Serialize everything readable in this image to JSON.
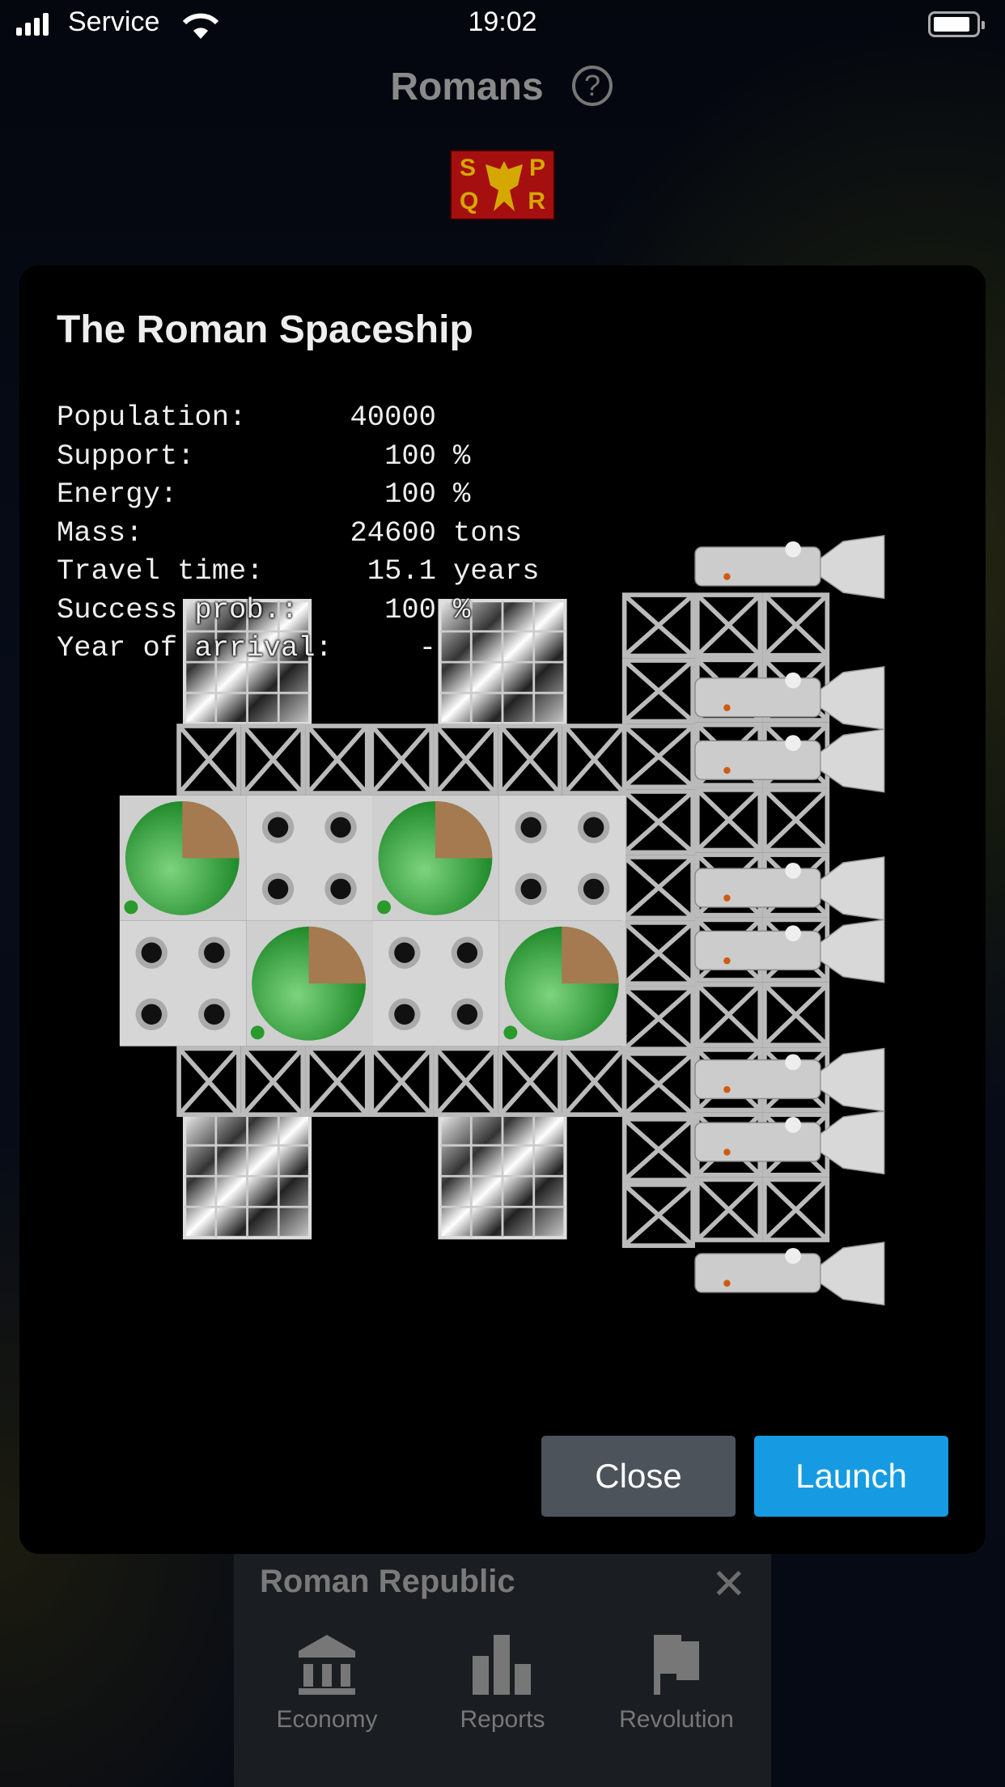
{
  "status_bar": {
    "carrier": "Service",
    "time": "19:02",
    "battery_level": 1.0
  },
  "header": {
    "title": "Romans",
    "help_icon": "question-circle-icon",
    "flag": {
      "letters": [
        "S",
        "P",
        "Q",
        "R"
      ],
      "colors": {
        "field": "#a50f0f",
        "emblem": "#d4a800"
      }
    }
  },
  "dialog": {
    "title": "The Roman Spaceship",
    "stats": [
      {
        "label": "Population:",
        "value": "40000",
        "unit": ""
      },
      {
        "label": "Support:",
        "value": "100",
        "unit": "%"
      },
      {
        "label": "Energy:",
        "value": "100",
        "unit": "%"
      },
      {
        "label": "Mass:",
        "value": "24600",
        "unit": "tons"
      },
      {
        "label": "Travel time:",
        "value": "15.1",
        "unit": "years"
      },
      {
        "label": "Success prob.:",
        "value": "100",
        "unit": "%"
      },
      {
        "label": "Year of arrival:",
        "value": "-",
        "unit": ""
      }
    ],
    "buttons": {
      "close": "Close",
      "launch": "Launch"
    },
    "colors": {
      "launch": "#169be3",
      "close": "#4c535a"
    }
  },
  "bottom_panel": {
    "title": "Roman Republic",
    "close_icon": "close-x-icon",
    "tabs": [
      {
        "label": "Economy",
        "icon": "bank-icon"
      },
      {
        "label": "Reports",
        "icon": "bar-chart-icon"
      },
      {
        "label": "Revolution",
        "icon": "flag-icon"
      }
    ]
  }
}
